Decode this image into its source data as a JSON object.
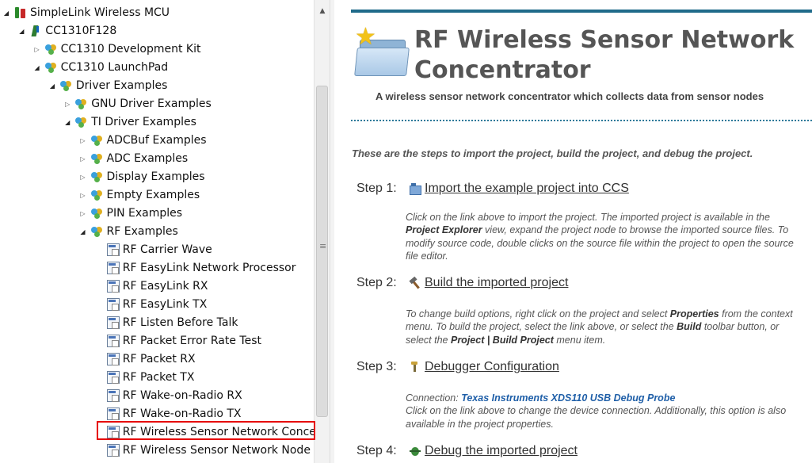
{
  "tree": {
    "items": [
      {
        "label": "SimpleLink Wireless MCU",
        "depth": 0,
        "expanded": true,
        "icon": "simplelink-root-icon"
      },
      {
        "label": "CC1310F128",
        "depth": 1,
        "expanded": true,
        "icon": "device-chip-icon"
      },
      {
        "label": "CC1310 Development Kit",
        "depth": 2,
        "expanded": false,
        "icon": "package-icon"
      },
      {
        "label": "CC1310 LaunchPad",
        "depth": 2,
        "expanded": true,
        "icon": "package-icon"
      },
      {
        "label": "Driver Examples",
        "depth": 3,
        "expanded": true,
        "icon": "package-icon"
      },
      {
        "label": "GNU Driver Examples",
        "depth": 4,
        "expanded": false,
        "icon": "package-icon"
      },
      {
        "label": "TI Driver Examples",
        "depth": 4,
        "expanded": true,
        "icon": "package-icon"
      },
      {
        "label": "ADCBuf Examples",
        "depth": 5,
        "expanded": false,
        "icon": "package-icon"
      },
      {
        "label": "ADC Examples",
        "depth": 5,
        "expanded": false,
        "icon": "package-icon"
      },
      {
        "label": "Display Examples",
        "depth": 5,
        "expanded": false,
        "icon": "package-icon"
      },
      {
        "label": "Empty Examples",
        "depth": 5,
        "expanded": false,
        "icon": "package-icon"
      },
      {
        "label": "PIN Examples",
        "depth": 5,
        "expanded": false,
        "icon": "package-icon"
      },
      {
        "label": "RF Examples",
        "depth": 5,
        "expanded": true,
        "icon": "package-icon"
      },
      {
        "label": "RF Carrier Wave",
        "depth": 6,
        "icon": "example-project-icon"
      },
      {
        "label": "RF EasyLink Network Processor",
        "depth": 6,
        "icon": "example-project-icon"
      },
      {
        "label": "RF EasyLink RX",
        "depth": 6,
        "icon": "example-project-icon"
      },
      {
        "label": "RF EasyLink TX",
        "depth": 6,
        "icon": "example-project-icon"
      },
      {
        "label": "RF Listen Before Talk",
        "depth": 6,
        "icon": "example-project-icon"
      },
      {
        "label": "RF Packet Error Rate Test",
        "depth": 6,
        "icon": "example-project-icon"
      },
      {
        "label": "RF Packet RX",
        "depth": 6,
        "icon": "example-project-icon"
      },
      {
        "label": "RF Packet TX",
        "depth": 6,
        "icon": "example-project-icon"
      },
      {
        "label": "RF Wake-on-Radio RX",
        "depth": 6,
        "icon": "example-project-icon"
      },
      {
        "label": "RF Wake-on-Radio TX",
        "depth": 6,
        "icon": "example-project-icon"
      },
      {
        "label": "RF Wireless Sensor Network Concentr",
        "depth": 6,
        "icon": "example-project-icon",
        "selected": true
      },
      {
        "label": "RF Wireless Sensor Network Node",
        "depth": 6,
        "icon": "example-project-icon"
      }
    ],
    "highlight_color": "#e60000"
  },
  "content": {
    "title": "RF Wireless Sensor Network Concentrator",
    "subtitle": "A wireless sensor network concentrator which collects data from sensor nodes",
    "intro": "These are the steps to import the project, build the project, and debug the project.",
    "accent_color": "#1f6b8a",
    "steps": [
      {
        "number": "Step 1:",
        "icon": "import-project-icon",
        "link": "Import the example project into CCS",
        "desc_parts": [
          "Click on the link above to import the project. The imported project is available in the ",
          "Project Explorer",
          " view, expand the project node to browse the imported source files. To modify source code, double clicks on the source file within the project to open the source file editor."
        ]
      },
      {
        "number": "Step 2:",
        "icon": "hammer-icon",
        "link": "Build the imported project",
        "desc_parts": [
          "To change build options, right click on the project and select ",
          "Properties",
          " from the context menu. To build the project, select the link above, or select the ",
          "Build",
          " toolbar button, or select the ",
          "Project | Build Project",
          " menu item."
        ]
      },
      {
        "number": "Step 3:",
        "icon": "debugger-config-icon",
        "link": "Debugger Configuration",
        "connection_label": "Connection: ",
        "connection_value": "Texas Instruments XDS110 USB Debug Probe",
        "desc": "Click on the link above to change the device connection. Additionally, this option is also available in the project properties."
      },
      {
        "number": "Step 4:",
        "icon": "debug-bug-icon",
        "link": "Debug the imported project"
      }
    ]
  }
}
